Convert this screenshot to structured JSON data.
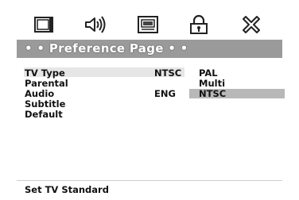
{
  "tabs": [
    {
      "icon": "monitor-icon"
    },
    {
      "icon": "speaker-icon"
    },
    {
      "icon": "video-settings-icon"
    },
    {
      "icon": "lock-icon"
    },
    {
      "icon": "close-icon"
    }
  ],
  "page_title": "• • Preference Page • •",
  "menu": {
    "items": [
      {
        "label": "TV Type",
        "value": "NTSC"
      },
      {
        "label": "Parental",
        "value": ""
      },
      {
        "label": "Audio",
        "value": "ENG"
      },
      {
        "label": "Subtitle",
        "value": ""
      },
      {
        "label": "Default",
        "value": ""
      }
    ],
    "selected_index": 0
  },
  "options": {
    "items": [
      "PAL",
      "Multi",
      "NTSC"
    ],
    "active_index": 2
  },
  "status_text": "Set TV Standard",
  "colors": {
    "title_bar": "#9a9a9a",
    "selected_row": "#e6e6e6",
    "active_option": "#b8b8b8"
  }
}
